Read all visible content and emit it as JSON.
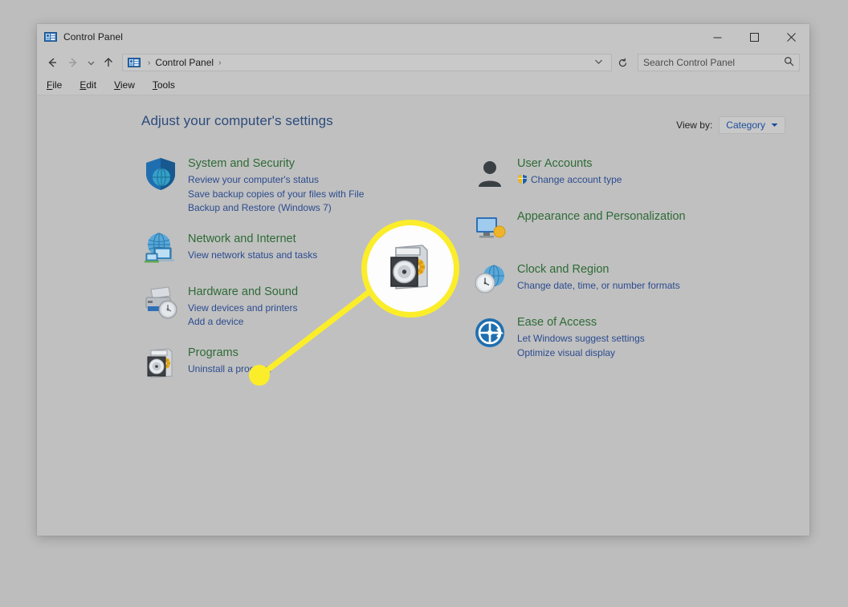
{
  "window": {
    "title": "Control Panel",
    "icon": "control-panel-icon",
    "buttons": {
      "minimize": "─",
      "maximize": "□",
      "close": "✕"
    }
  },
  "navbar": {
    "back": "←",
    "forward": "→",
    "recent": "⌄",
    "up": "↑",
    "breadcrumb": {
      "root_icon": "control-panel-icon",
      "separator": "›",
      "items": [
        "Control Panel"
      ],
      "dropdown": "⌄"
    },
    "refresh": "↻",
    "search": {
      "placeholder": "Search Control Panel",
      "icon": "🔍"
    }
  },
  "menubar": {
    "items": [
      {
        "pre": "",
        "key": "F",
        "post": "ile"
      },
      {
        "pre": "",
        "key": "E",
        "post": "dit"
      },
      {
        "pre": "",
        "key": "V",
        "post": "iew"
      },
      {
        "pre": "",
        "key": "T",
        "post": "ools"
      }
    ]
  },
  "main": {
    "title": "Adjust your computer's settings",
    "view_by_label": "View by:",
    "view_by_value": "Category",
    "view_by_caret": "▼"
  },
  "categories": {
    "left": [
      {
        "icon": "shield-security-icon",
        "title": "System and Security",
        "links": [
          {
            "text": "Review your computer's status",
            "shield": false
          },
          {
            "text": "Save backup copies of your files with File",
            "shield": false
          },
          {
            "text": "Backup and Restore (Windows 7)",
            "shield": false
          }
        ]
      },
      {
        "icon": "network-globe-icon",
        "title": "Network and Internet",
        "links": [
          {
            "text": "View network status and tasks",
            "shield": false
          }
        ]
      },
      {
        "icon": "printer-hardware-icon",
        "title": "Hardware and Sound",
        "links": [
          {
            "text": "View devices and printers",
            "shield": false
          },
          {
            "text": "Add a device",
            "shield": false
          }
        ]
      },
      {
        "icon": "programs-disc-icon",
        "title": "Programs",
        "links": [
          {
            "text": "Uninstall a program",
            "shield": false
          }
        ]
      }
    ],
    "right": [
      {
        "icon": "user-accounts-icon",
        "title": "User Accounts",
        "links": [
          {
            "text": "Change account type",
            "shield": true
          }
        ]
      },
      {
        "icon": "appearance-icon",
        "title": "Appearance and Personalization",
        "links": []
      },
      {
        "icon": "clock-region-icon",
        "title": "Clock and Region",
        "links": [
          {
            "text": "Change date, time, or number formats",
            "shield": false
          }
        ]
      },
      {
        "icon": "ease-of-access-icon",
        "title": "Ease of Access",
        "links": [
          {
            "text": "Let Windows suggest settings",
            "shield": false
          },
          {
            "text": "Optimize visual display",
            "shield": false
          }
        ]
      }
    ]
  },
  "callout": {
    "highlight_icon": "programs-disc-icon",
    "ring_color": "#fbed2a",
    "target": "programs-category"
  },
  "colors": {
    "page_background": "#bdbdbd",
    "window_chrome": "#c5c5c5",
    "content_background": "#c0c0c0",
    "heading": "#2b4b7c",
    "category_title": "#2e6b36",
    "link": "#2b4b8f",
    "callout_yellow": "#fbed2a"
  }
}
